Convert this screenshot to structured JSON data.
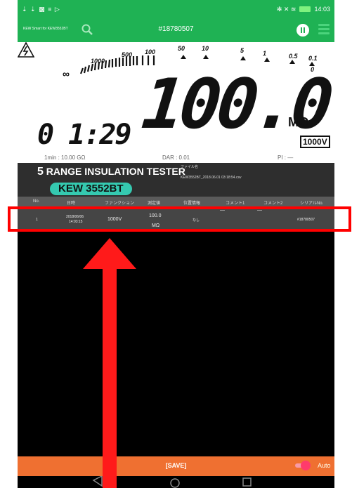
{
  "status_bar": {
    "left_icons": "⇣ ⇣ ▩ ≡ ▷",
    "right_icons": "✻ ✕ ≋",
    "time": "14:03"
  },
  "app_bar": {
    "title": "KEW Smart for KEW3552BT",
    "device_id": "#18780507"
  },
  "meter": {
    "scale_labels": [
      "1000",
      "500",
      "100",
      "50",
      "10",
      "5",
      "1",
      "0.5",
      "0.1",
      "0",
      "∞"
    ],
    "reading": "100.0",
    "unit": "MΩ",
    "voltage_range": "1000V",
    "elapsed_time": "0 1:29",
    "one_min_label": "1min : 10.00 GΩ",
    "dar_label": "DAR : 0.01",
    "pi_label": "PI : —"
  },
  "tester": {
    "name_number": "5",
    "name_text": "RANGE INSULATION TESTER",
    "model": "KEW 3552BT",
    "file_label": "ファイル名",
    "file_name": "KEW3552BT_2018.06.01 03:18:54.csv"
  },
  "table": {
    "headers": [
      "No.",
      "日時",
      "ファンクション",
      "測定値",
      "位置情報",
      "コメント1",
      "コメント2",
      "シリアルNo."
    ],
    "rows": [
      {
        "no": "1",
        "date": "2018/06/06",
        "time": "14:03:15",
        "function": "1000V",
        "value": "100.0",
        "value_unit": "MΩ",
        "location": "なし",
        "comment1": "—",
        "comment2": "—",
        "serial": "#18780507"
      }
    ]
  },
  "bottom_bar": {
    "save_label": "[SAVE]",
    "auto_label": "Auto"
  },
  "colors": {
    "header_green": "#1fb254",
    "accent_orange": "#ef7031",
    "model_teal": "#35c9b0",
    "annotation_red": "#ff0000"
  }
}
